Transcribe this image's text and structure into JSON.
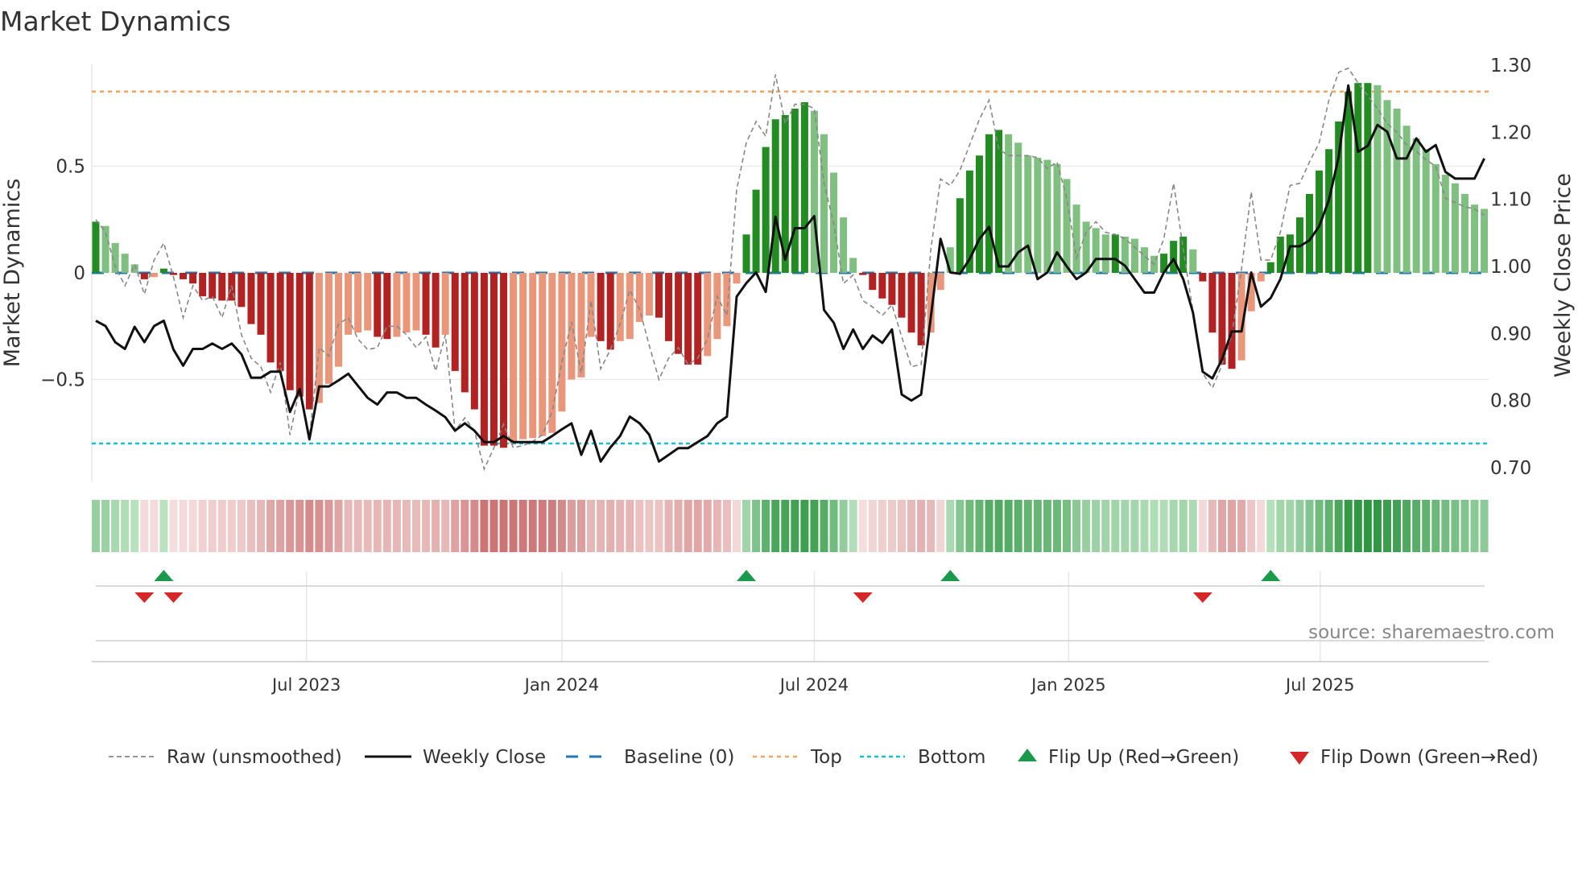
{
  "title": "Market Dynamics",
  "source": "source: sharemaestro.com",
  "colors": {
    "strong_green": "#228b22",
    "weak_green": "#7fbf7f",
    "strong_red": "#b22222",
    "weak_red": "#e9967a",
    "close": "#111111",
    "raw": "#888888",
    "baseline": "#1f77b4",
    "top": "#f4a460",
    "bottom": "#17becf",
    "flip_up": "#1a9a4a",
    "flip_down": "#d62728"
  },
  "chart_data": {
    "type": "bar",
    "title": "Market Dynamics",
    "ylabel": "Market Dynamics",
    "y2label": "Weekly Close Price",
    "ylim": [
      -0.95,
      1.0
    ],
    "y2lim": [
      0.68,
      1.32
    ],
    "y_ticks": [
      {
        "v": 0.5,
        "label": "0.5"
      },
      {
        "v": 0,
        "label": "0"
      },
      {
        "v": -0.5,
        "label": "−0.5"
      }
    ],
    "y2_ticks": [
      {
        "v": 1.3,
        "label": "1.30"
      },
      {
        "v": 1.2,
        "label": "1.20"
      },
      {
        "v": 1.1,
        "label": "1.10"
      },
      {
        "v": 1.0,
        "label": "1.00"
      },
      {
        "v": 0.9,
        "label": "0.90"
      },
      {
        "v": 0.8,
        "label": "0.80"
      },
      {
        "v": 0.7,
        "label": "0.70"
      }
    ],
    "x_ticks": [
      {
        "week": 21.7,
        "label": "Jul 2023"
      },
      {
        "week": 48.0,
        "label": "Jan 2024"
      },
      {
        "week": 74.0,
        "label": "Jul 2024"
      },
      {
        "week": 100.2,
        "label": "Jan 2025"
      },
      {
        "week": 126.1,
        "label": "Jul 2025"
      }
    ],
    "top_level": 0.85,
    "bottom_level": -0.8,
    "baseline": 0,
    "weak_override_weeks": [
      89
    ],
    "market_dynamics": [
      0.24,
      0.22,
      0.14,
      0.09,
      0.04,
      -0.03,
      -0.02,
      0.02,
      -0.01,
      -0.03,
      -0.05,
      -0.11,
      -0.12,
      -0.13,
      -0.13,
      -0.16,
      -0.24,
      -0.29,
      -0.42,
      -0.46,
      -0.55,
      -0.58,
      -0.64,
      -0.61,
      -0.52,
      -0.44,
      -0.29,
      -0.28,
      -0.27,
      -0.3,
      -0.31,
      -0.3,
      -0.28,
      -0.27,
      -0.29,
      -0.35,
      -0.29,
      -0.46,
      -0.56,
      -0.64,
      -0.81,
      -0.81,
      -0.82,
      -0.8,
      -0.78,
      -0.775,
      -0.765,
      -0.75,
      -0.65,
      -0.5,
      -0.49,
      -0.3,
      -0.32,
      -0.36,
      -0.32,
      -0.31,
      -0.23,
      -0.2,
      -0.21,
      -0.32,
      -0.38,
      -0.43,
      -0.43,
      -0.39,
      -0.31,
      -0.25,
      -0.05,
      0.18,
      0.39,
      0.59,
      0.72,
      0.74,
      0.77,
      0.8,
      0.76,
      0.65,
      0.47,
      0.26,
      0.07,
      -0.01,
      -0.08,
      -0.12,
      -0.15,
      -0.21,
      -0.28,
      -0.34,
      -0.28,
      -0.08,
      0.12,
      0.35,
      0.48,
      0.55,
      0.65,
      0.67,
      0.65,
      0.61,
      0.55,
      0.54,
      0.53,
      0.51,
      0.44,
      0.32,
      0.24,
      0.21,
      0.18,
      0.18,
      0.17,
      0.16,
      0.12,
      0.08,
      0.09,
      0.15,
      0.17,
      0.11,
      -0.04,
      -0.28,
      -0.43,
      -0.45,
      -0.41,
      -0.18,
      -0.04,
      0.05,
      0.17,
      0.18,
      0.26,
      0.37,
      0.48,
      0.58,
      0.71,
      0.85,
      0.89,
      0.89,
      0.88,
      0.81,
      0.77,
      0.69,
      0.63,
      0.58,
      0.51,
      0.46,
      0.42,
      0.37,
      0.32,
      0.3
    ],
    "raw": [
      0.25,
      0.19,
      0.03,
      -0.06,
      0.04,
      -0.1,
      0.06,
      0.14,
      -0.02,
      -0.21,
      -0.06,
      -0.13,
      -0.11,
      -0.21,
      -0.06,
      -0.29,
      -0.4,
      -0.44,
      -0.56,
      -0.42,
      -0.76,
      -0.54,
      -0.77,
      -0.35,
      -0.39,
      -0.24,
      -0.21,
      -0.31,
      -0.36,
      -0.35,
      -0.25,
      -0.25,
      -0.29,
      -0.35,
      -0.3,
      -0.46,
      -0.29,
      -0.74,
      -0.68,
      -0.74,
      -0.92,
      -0.82,
      -0.71,
      -0.82,
      -0.81,
      -0.79,
      -0.76,
      -0.65,
      -0.42,
      -0.23,
      -0.47,
      -0.13,
      -0.45,
      -0.36,
      -0.24,
      -0.08,
      -0.17,
      -0.34,
      -0.5,
      -0.4,
      -0.35,
      -0.43,
      -0.4,
      -0.31,
      -0.11,
      -0.2,
      0.39,
      0.61,
      0.71,
      0.64,
      0.93,
      0.7,
      0.79,
      0.79,
      0.77,
      0.42,
      0.23,
      -0.05,
      -0.01,
      -0.13,
      -0.16,
      -0.2,
      -0.15,
      -0.3,
      -0.44,
      -0.43,
      0.11,
      0.44,
      0.41,
      0.48,
      0.6,
      0.72,
      0.81,
      0.58,
      0.55,
      0.55,
      0.55,
      0.54,
      0.49,
      0.52,
      0.35,
      0.07,
      0.19,
      0.24,
      0.19,
      0.18,
      0.16,
      0.12,
      0.08,
      0.04,
      0.16,
      0.42,
      0.11,
      -0.18,
      -0.47,
      -0.54,
      -0.43,
      -0.29,
      0.02,
      0.38,
      0.06,
      0.06,
      0.19,
      0.41,
      0.42,
      0.52,
      0.61,
      0.81,
      0.94,
      0.96,
      0.89,
      0.83,
      0.77,
      0.7,
      0.66,
      0.6,
      0.57,
      0.53,
      0.5,
      0.35,
      0.33,
      0.31,
      0.3,
      0.27
    ],
    "weekly_close": [
      0.919,
      0.911,
      0.887,
      0.877,
      0.91,
      0.887,
      0.911,
      0.919,
      0.876,
      0.852,
      0.877,
      0.877,
      0.885,
      0.877,
      0.885,
      0.869,
      0.834,
      0.834,
      0.843,
      0.843,
      0.783,
      0.817,
      0.742,
      0.821,
      0.821,
      0.83,
      0.84,
      0.822,
      0.804,
      0.794,
      0.812,
      0.812,
      0.804,
      0.804,
      0.794,
      0.785,
      0.775,
      0.755,
      0.766,
      0.755,
      0.738,
      0.738,
      0.747,
      0.738,
      0.738,
      0.738,
      0.738,
      0.747,
      0.757,
      0.766,
      0.719,
      0.755,
      0.709,
      0.73,
      0.747,
      0.776,
      0.766,
      0.749,
      0.709,
      0.719,
      0.729,
      0.729,
      0.738,
      0.747,
      0.766,
      0.776,
      0.955,
      0.975,
      0.991,
      0.962,
      1.074,
      1.01,
      1.057,
      1.057,
      1.075,
      0.935,
      0.916,
      0.877,
      0.906,
      0.877,
      0.897,
      0.886,
      0.906,
      0.809,
      0.8,
      0.809,
      0.925,
      1.041,
      0.991,
      0.989,
      1.011,
      1.041,
      1.059,
      1.0,
      1.0,
      1.021,
      1.031,
      0.981,
      0.991,
      1.021,
      1.0,
      0.981,
      0.991,
      1.011,
      1.011,
      1.011,
      1.001,
      0.981,
      0.961,
      0.961,
      0.991,
      1.011,
      0.981,
      0.931,
      0.843,
      0.833,
      0.862,
      0.903,
      0.903,
      0.991,
      0.94,
      0.953,
      0.981,
      1.03,
      1.03,
      1.039,
      1.06,
      1.099,
      1.163,
      1.27,
      1.171,
      1.18,
      1.211,
      1.201,
      1.161,
      1.161,
      1.191,
      1.171,
      1.181,
      1.141,
      1.131,
      1.131,
      1.131,
      1.161
    ],
    "flip_up_weeks": [
      8,
      68,
      89,
      122
    ],
    "flip_down_weeks": [
      6,
      9,
      80,
      115
    ],
    "legend": {
      "placement": "bottom",
      "items": [
        {
          "key": "raw",
          "label": "Raw (unsmoothed)"
        },
        {
          "key": "close",
          "label": "Weekly Close"
        },
        {
          "key": "baseline",
          "label": "Baseline (0)"
        },
        {
          "key": "top",
          "label": "Top"
        },
        {
          "key": "bottom",
          "label": "Bottom"
        },
        {
          "key": "flip_up",
          "label": "Flip Up (Red→Green)"
        },
        {
          "key": "flip_down",
          "label": "Flip Down (Green→Red)"
        }
      ]
    }
  }
}
